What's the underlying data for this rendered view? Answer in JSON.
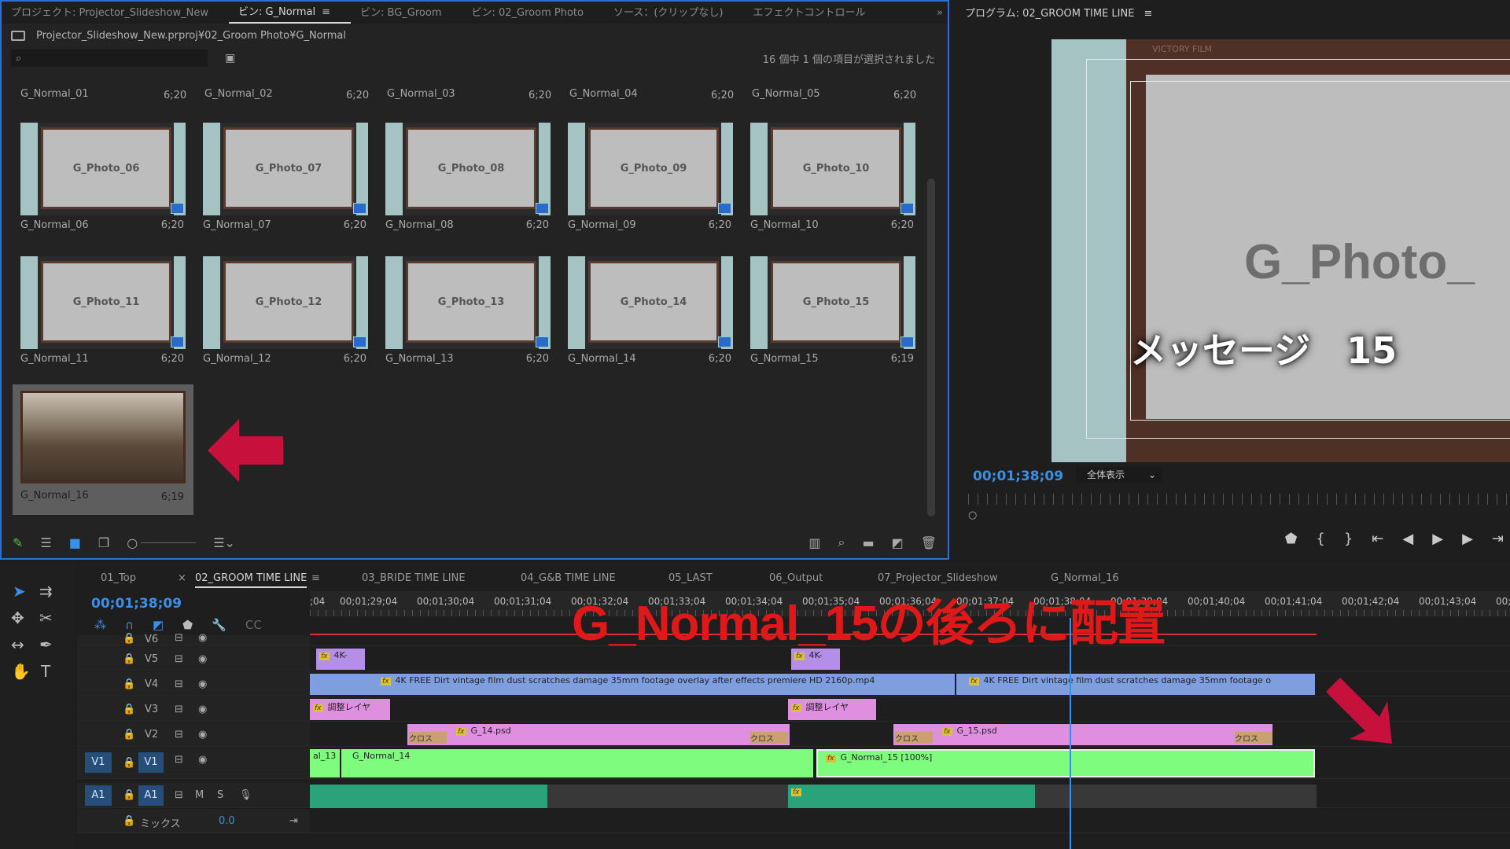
{
  "project_panel": {
    "tabs": [
      "プロジェクト: Projector_Slideshow_New",
      "ビン: G_Normal",
      "ビン: BG_Groom",
      "ビン: 02_Groom Photo",
      "ソース：(クリップなし)",
      "エフェクトコントロール"
    ],
    "active_tab_index": 1,
    "path": "Projector_Slideshow_New.prproj¥02_Groom Photo¥G_Normal",
    "selection_info": "16 個中 1 個の項目が選択されました",
    "top_row": [
      {
        "name": "G_Normal_01",
        "dur": "6;20"
      },
      {
        "name": "G_Normal_02",
        "dur": "6;20"
      },
      {
        "name": "G_Normal_03",
        "dur": "6;20"
      },
      {
        "name": "G_Normal_04",
        "dur": "6;20"
      },
      {
        "name": "G_Normal_05",
        "dur": "6;20"
      }
    ],
    "items": [
      {
        "photo": "G_Photo_06",
        "name": "G_Normal_06",
        "dur": "6;20"
      },
      {
        "photo": "G_Photo_07",
        "name": "G_Normal_07",
        "dur": "6;20"
      },
      {
        "photo": "G_Photo_08",
        "name": "G_Normal_08",
        "dur": "6;20"
      },
      {
        "photo": "G_Photo_09",
        "name": "G_Normal_09",
        "dur": "6;20"
      },
      {
        "photo": "G_Photo_10",
        "name": "G_Normal_10",
        "dur": "6;20"
      },
      {
        "photo": "G_Photo_11",
        "name": "G_Normal_11",
        "dur": "6;20"
      },
      {
        "photo": "G_Photo_12",
        "name": "G_Normal_12",
        "dur": "6;20"
      },
      {
        "photo": "G_Photo_13",
        "name": "G_Normal_13",
        "dur": "6;20"
      },
      {
        "photo": "G_Photo_14",
        "name": "G_Normal_14",
        "dur": "6;20"
      },
      {
        "photo": "G_Photo_15",
        "name": "G_Normal_15",
        "dur": "6;19"
      }
    ],
    "selected_item": {
      "name": "G_Normal_16",
      "dur": "6;19"
    }
  },
  "program_monitor": {
    "title": "プログラム: 02_GROOM TIME LINE",
    "timecode": "00;01;38;09",
    "fit": "全体表示",
    "photo_text": "G_Photo_",
    "message_text": "メッセージ　15",
    "film_text": "VICTORY FILM"
  },
  "timeline": {
    "tabs": [
      "01_Top",
      "02_GROOM TIME LINE",
      "03_BRIDE TIME LINE",
      "04_G&B TIME LINE",
      "05_LAST",
      "06_Output",
      "07_Projector_Slideshow",
      "G_Normal_16"
    ],
    "active_tab_index": 1,
    "timecode": "00;01;38;09",
    "ruler": [
      ";04",
      "00;01;29;04",
      "00;01;30;04",
      "00;01;31;04",
      "00;01;32;04",
      "00;01;33;04",
      "00;01;34;04",
      "00;01;35;04",
      "00;01;36;04",
      "00;01;37;04",
      "00;01;38;04",
      "00;01;39;04",
      "00;01;40;04",
      "00;01;41;04",
      "00;01;42;04",
      "00;01;43;04",
      "00;"
    ],
    "tracks": [
      {
        "label": "V6"
      },
      {
        "label": "V5"
      },
      {
        "label": "V4"
      },
      {
        "label": "V3"
      },
      {
        "label": "V2"
      },
      {
        "label": "V1"
      },
      {
        "label": "A1"
      }
    ],
    "clips": {
      "v5_a": "4K-",
      "v5_b": "4K-",
      "v4_a": "4K FREE Dirt vintage film dust scratches damage 35mm footage overlay after effects premiere HD 2160p.mp4",
      "v4_b": "4K FREE Dirt vintage film dust scratches damage 35mm footage o",
      "v3_a": "調整レイヤ",
      "v3_b": "調整レイヤ",
      "v2_a": "G_14.psd",
      "v2_b": "G_15.psd",
      "cross": "クロス",
      "v1_prev": "al_13",
      "v1_a": "G_Normal_14",
      "v1_b": "G_Normal_15 [100%]"
    },
    "mix_label": "ミックス",
    "mix_value": "0.0"
  },
  "annotation": {
    "title": "G_Normal_15の後ろに配置",
    "color": "#e01818"
  }
}
